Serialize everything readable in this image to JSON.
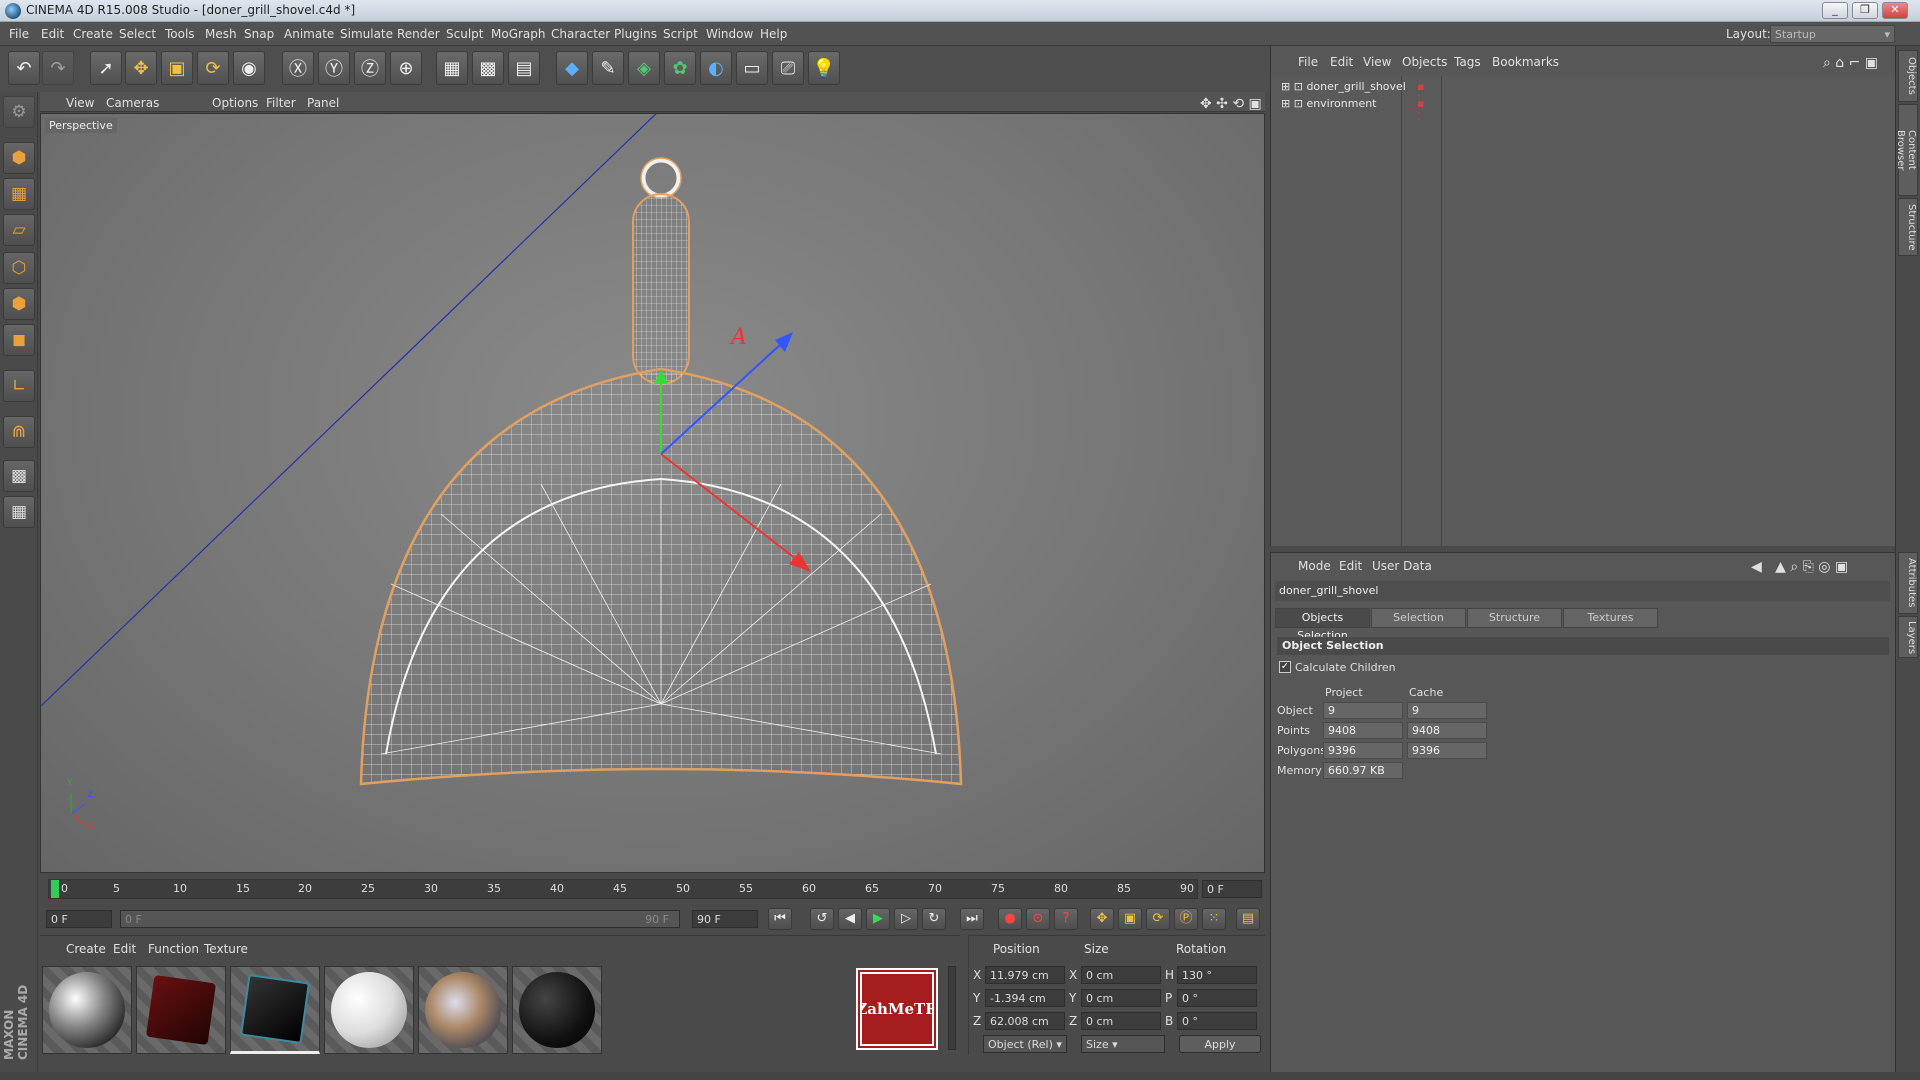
{
  "window": {
    "title": "CINEMA 4D R15.008 Studio - [doner_grill_shovel.c4d *]",
    "controls": [
      "_",
      "❐",
      "✕"
    ]
  },
  "menubar": {
    "items": [
      "File",
      "Edit",
      "Create",
      "Select",
      "Tools",
      "Mesh",
      "Snap",
      "Animate",
      "Simulate",
      "Render",
      "Sculpt",
      "MoGraph",
      "Character",
      "Plugins",
      "Script",
      "Window",
      "Help"
    ],
    "layout_label": "Layout:",
    "layout_value": "Startup"
  },
  "viewport": {
    "menu": [
      "View",
      "Cameras",
      "Options",
      "Filter",
      "Panel"
    ],
    "camera_label": "Perspective",
    "axis_labels": [
      "Y",
      "Z",
      "X"
    ]
  },
  "timeline": {
    "ticks": [
      "0",
      "5",
      "10",
      "15",
      "20",
      "25",
      "30",
      "35",
      "40",
      "45",
      "50",
      "55",
      "60",
      "65",
      "70",
      "75",
      "80",
      "85",
      "90"
    ],
    "current_frame": "0 F",
    "start_frame": "0 F",
    "range_start": "0 F",
    "range_end": "90 F",
    "end_frame": "90 F"
  },
  "materials": {
    "menu": [
      "Create",
      "Edit",
      "Function",
      "Texture"
    ],
    "logo_text": "ZahMeTR"
  },
  "coordinates": {
    "headers": [
      "Position",
      "Size",
      "Rotation"
    ],
    "rows": [
      {
        "axis": "X",
        "pos": "11.979 cm",
        "size_axis": "X",
        "size": "0 cm",
        "rot_axis": "H",
        "rot": "130 °"
      },
      {
        "axis": "Y",
        "pos": "-1.394 cm",
        "size_axis": "Y",
        "size": "0 cm",
        "rot_axis": "P",
        "rot": "0 °"
      },
      {
        "axis": "Z",
        "pos": "62.008 cm",
        "size_axis": "Z",
        "size": "0 cm",
        "rot_axis": "B",
        "rot": "0 °"
      }
    ],
    "mode_select": "Object (Rel)",
    "size_select": "Size",
    "apply_label": "Apply"
  },
  "object_manager": {
    "menu": [
      "File",
      "Edit",
      "View",
      "Objects",
      "Tags",
      "Bookmarks"
    ],
    "objects": [
      "doner_grill_shovel",
      "environment"
    ]
  },
  "attribute_manager": {
    "menu": [
      "Mode",
      "Edit",
      "User Data"
    ],
    "object_name": "doner_grill_shovel",
    "tabs": [
      "Objects Selection",
      "Selection",
      "Structure",
      "Textures"
    ],
    "section": "Object Selection",
    "checkbox_label": "Calculate Children",
    "col_project": "Project",
    "col_cache": "Cache",
    "rows": [
      {
        "label": "Object",
        "project": "9",
        "cache": "9"
      },
      {
        "label": "Points",
        "project": "9408",
        "cache": "9408"
      },
      {
        "label": "Polygons",
        "project": "9396",
        "cache": "9396"
      },
      {
        "label": "Memory",
        "project": "660.97 KB",
        "cache": ""
      }
    ]
  },
  "right_tabs": [
    "Objects",
    "Content Browser",
    "Structure",
    "Attributes",
    "Layers"
  ],
  "branding": "MAXON CINEMA 4D"
}
